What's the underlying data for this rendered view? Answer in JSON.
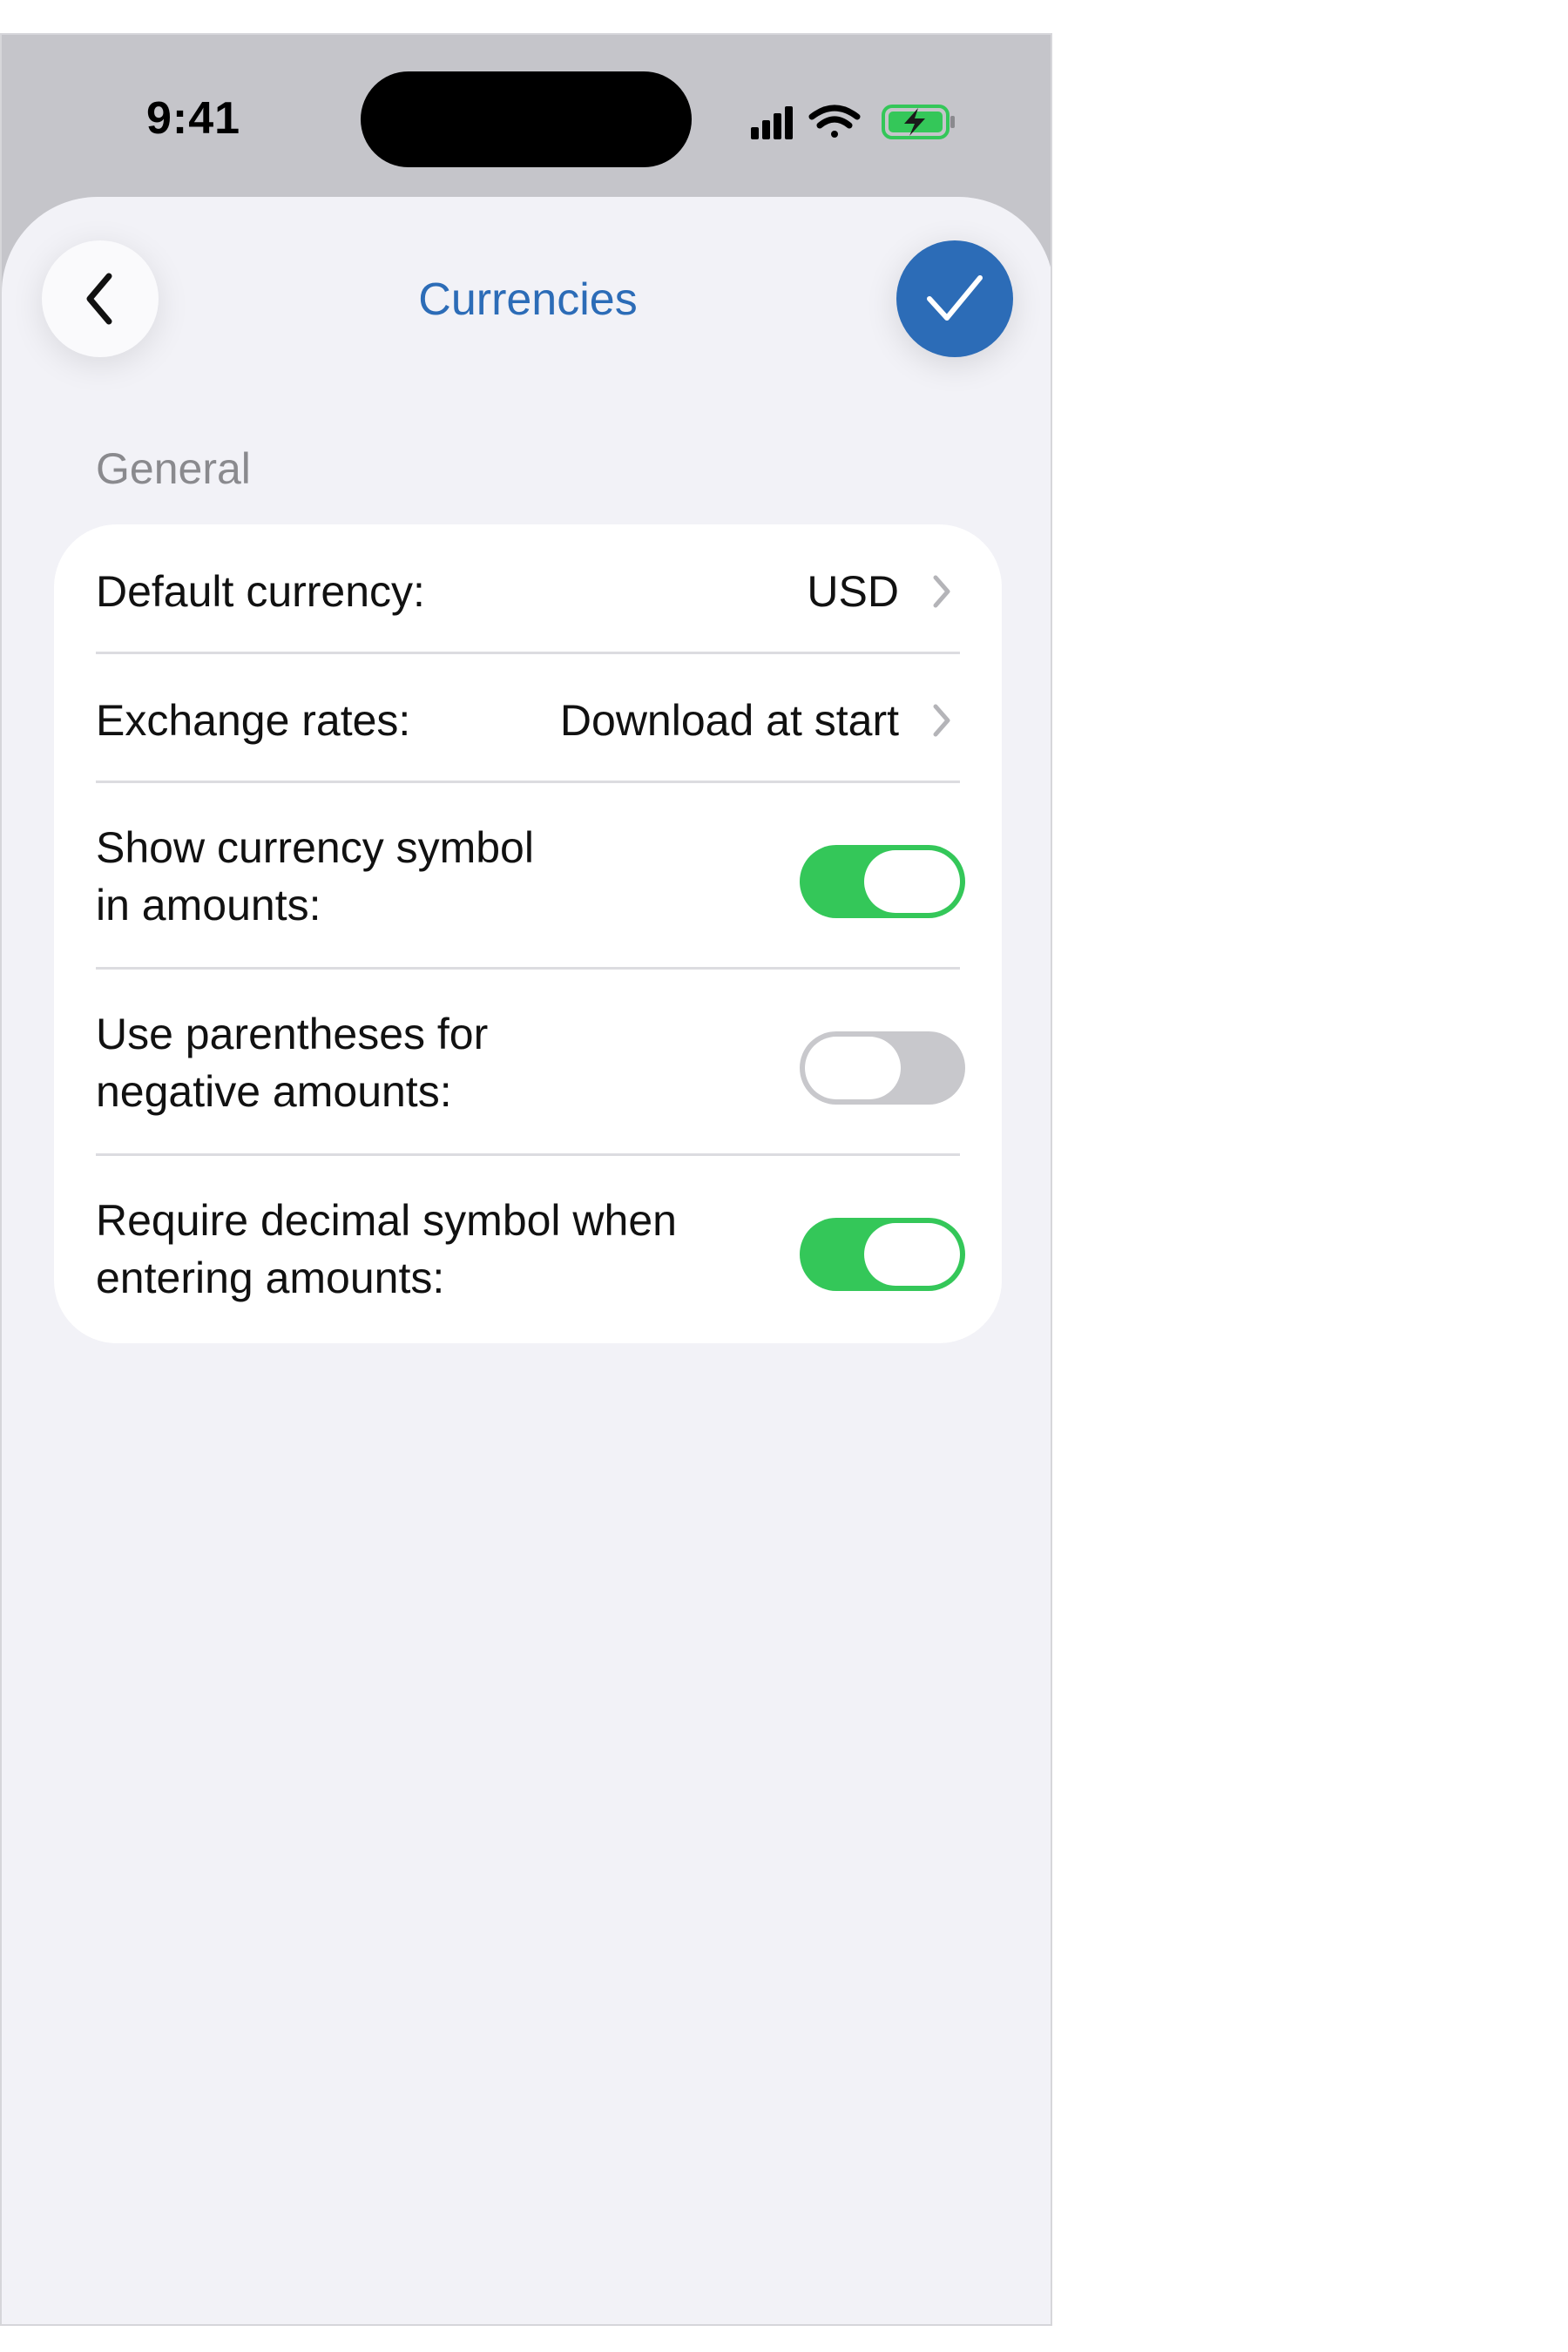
{
  "status_bar": {
    "time": "9:41",
    "icons": [
      "cellular-signal-icon",
      "wifi-icon",
      "battery-charging-icon"
    ]
  },
  "nav": {
    "title": "Currencies",
    "back_icon": "chevron-left-icon",
    "confirm_icon": "checkmark-icon"
  },
  "section": {
    "header": "General"
  },
  "settings": {
    "default_currency": {
      "label": "Default currency:",
      "value": "USD"
    },
    "exchange_rates": {
      "label": "Exchange rates:",
      "value": "Download at start"
    },
    "show_symbol": {
      "label_line1": "Show currency symbol",
      "label_line2": "in amounts:",
      "on": true
    },
    "parentheses": {
      "label_line1": "Use parentheses for",
      "label_line2": "negative amounts:",
      "on": false
    },
    "require_decimal": {
      "label_line1": "Require decimal symbol when",
      "label_line2": "entering amounts:",
      "on": true
    }
  },
  "colors": {
    "accent": "#2c6cb7",
    "toggle_on": "#34c759",
    "toggle_off": "#c8c8cc",
    "background": "#f2f2f7"
  }
}
